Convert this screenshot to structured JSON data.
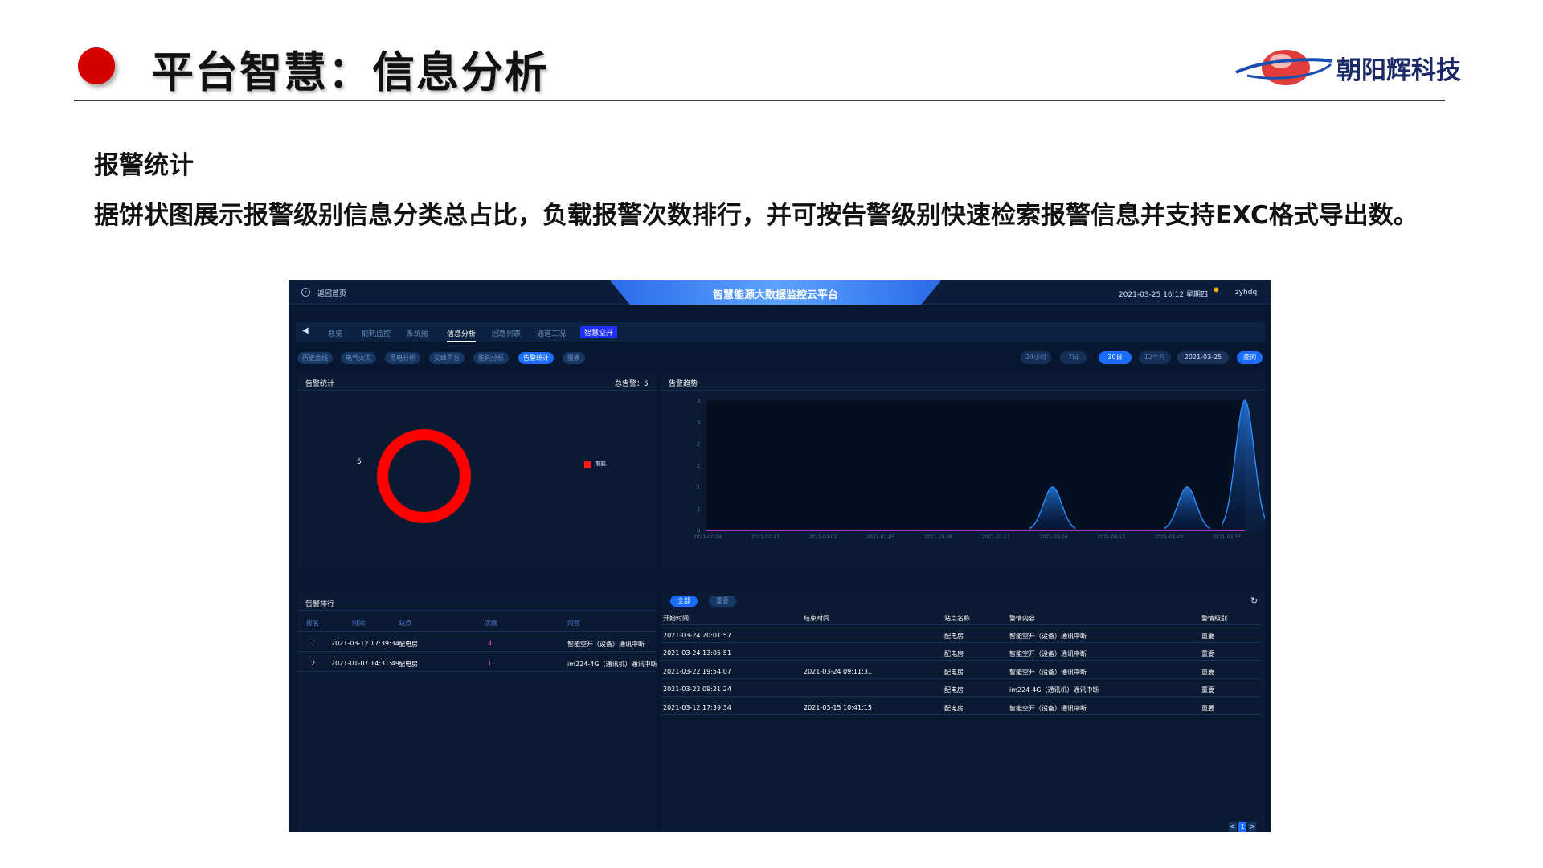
{
  "slide": {
    "title": "平台智慧：信息分析",
    "brand": "朝阳辉科技",
    "section_title": "报警统计",
    "description": "据饼状图展示报警级别信息分类总占比，负载报警次数排行，并可按告警级别快速检索报警信息并支持EXC格式导出数。"
  },
  "dashboard": {
    "back_label": "返回首页",
    "title": "智慧能源大数据监控云平台",
    "datetime": "2021-03-25 16:12 星期四",
    "user": "zyhdq",
    "nav": [
      {
        "label": "总览",
        "active": false
      },
      {
        "label": "能耗监控",
        "active": false
      },
      {
        "label": "系统图",
        "active": false
      },
      {
        "label": "信息分析",
        "active": true
      },
      {
        "label": "回路列表",
        "active": false
      },
      {
        "label": "通道工况",
        "active": false
      },
      {
        "label": "智慧空开",
        "active": false,
        "badge": true
      }
    ],
    "subtabs": [
      {
        "label": "历史曲线",
        "active": false
      },
      {
        "label": "电气火灾",
        "active": false
      },
      {
        "label": "用电分析",
        "active": false
      },
      {
        "label": "尖峰平谷",
        "active": false
      },
      {
        "label": "能耗分析",
        "active": false
      },
      {
        "label": "告警统计",
        "active": true
      },
      {
        "label": "报表",
        "active": false
      }
    ],
    "ranges": [
      {
        "label": "24小时",
        "active": false
      },
      {
        "label": "7日",
        "active": false
      },
      {
        "label": "30日",
        "active": true
      },
      {
        "label": "12个月",
        "active": false
      }
    ],
    "date_value": "2021-03-25",
    "query_label": "查询",
    "alarm_stats": {
      "title": "告警统计",
      "total_label": "总告警：5",
      "donut_value": "5",
      "legend": "重要",
      "legend_color": "#ff1a1a"
    },
    "trend": {
      "title": "告警趋势"
    },
    "ranking": {
      "title": "告警排行",
      "headers": [
        "排名",
        "时间",
        "站点",
        "次数",
        "内容"
      ],
      "rows": [
        [
          "1",
          "2021-03-12 17:39:34",
          "配电房",
          "4",
          "智能空开（设备）通讯中断"
        ],
        [
          "2",
          "2021-01-07 14:31:49",
          "配电房",
          "1",
          "im224-4G（通讯机）通讯中断"
        ]
      ]
    },
    "alarm_list": {
      "tabs": [
        {
          "label": "全部",
          "active": true
        },
        {
          "label": "重要",
          "active": false
        }
      ],
      "headers": [
        "开始时间",
        "结束时间",
        "站点名称",
        "警情内容",
        "警情级别"
      ],
      "rows": [
        [
          "2021-03-24 20:01:57",
          "",
          "配电房",
          "智能空开（设备）通讯中断",
          "重要"
        ],
        [
          "2021-03-24 13:05:51",
          "",
          "配电房",
          "智能空开（设备）通讯中断",
          "重要"
        ],
        [
          "2021-03-22 19:54:07",
          "2021-03-24 09:11:31",
          "配电房",
          "智能空开（设备）通讯中断",
          "重要"
        ],
        [
          "2021-03-22 09:21:24",
          "",
          "配电房",
          "im224-4G（通讯机）通讯中断",
          "重要"
        ],
        [
          "2021-03-12 17:39:34",
          "2021-03-15 10:41:15",
          "配电房",
          "智能空开（设备）通讯中断",
          "重要"
        ]
      ],
      "pager": {
        "prev": "<",
        "current": "1",
        "next": ">"
      }
    }
  },
  "chart_data": {
    "type": "area",
    "x": [
      "2021-02-24",
      "2021-02-27",
      "2021-03-02",
      "2021-03-05",
      "2021-03-08",
      "2021-03-11",
      "2021-03-14",
      "2021-03-17",
      "2021-03-20",
      "2021-03-23"
    ],
    "yticks": [
      "0",
      "1",
      "1",
      "2",
      "2",
      "3",
      "3"
    ],
    "ylim": [
      0,
      3
    ],
    "peaks": [
      {
        "date": "2021-03-14",
        "value": 1
      },
      {
        "date": "2021-03-21",
        "value": 1
      },
      {
        "date": "2021-03-24",
        "value": 3
      }
    ],
    "line_color": "#2b8bff",
    "baseline_color": "#e23bff"
  }
}
